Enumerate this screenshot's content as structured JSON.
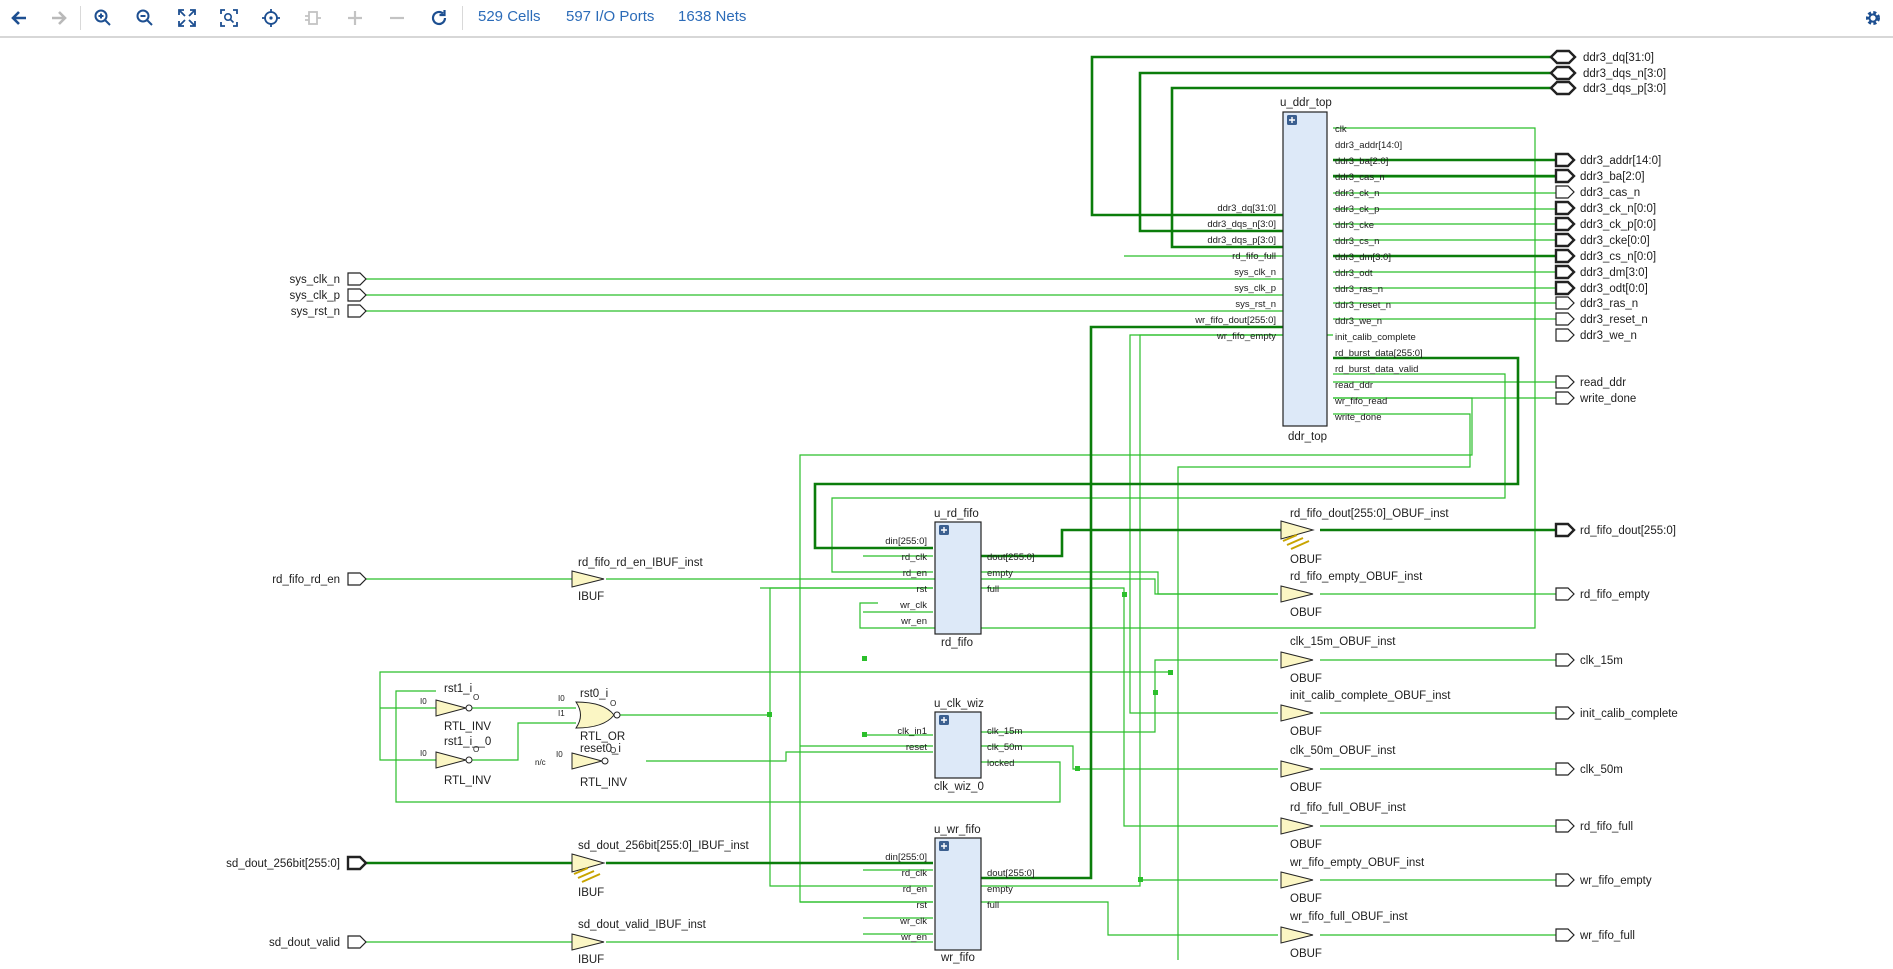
{
  "toolbar": {
    "buttons": [
      {
        "id": "back",
        "icon": "arrow-left-icon"
      },
      {
        "id": "forward",
        "icon": "arrow-right-icon"
      },
      {
        "id": "zoom_in",
        "icon": "zoom-in-icon"
      },
      {
        "id": "zoom_out",
        "icon": "zoom-out-icon"
      },
      {
        "id": "fit",
        "icon": "fit-view-icon"
      },
      {
        "id": "zoom_select",
        "icon": "zoom-selection-icon"
      },
      {
        "id": "autofit",
        "icon": "crosshair-icon"
      },
      {
        "id": "regen",
        "icon": "regenerate-icon"
      },
      {
        "id": "expand",
        "icon": "plus-icon"
      },
      {
        "id": "collapse",
        "icon": "minus-icon"
      },
      {
        "id": "reload",
        "icon": "reload-icon"
      }
    ],
    "cells_label": "529 Cells",
    "ports_label": "597 I/O Ports",
    "nets_label": "1638 Nets",
    "settings_icon": "gear-icon"
  },
  "colors": {
    "wire": "#2bbf2b",
    "bus": "#0b7d0b",
    "block": "#dde9f8",
    "buffer": "#fbf6c4",
    "accent": "#2b6bb8"
  },
  "ports_in": {
    "sys_clk_n": "sys_clk_n",
    "sys_clk_p": "sys_clk_p",
    "sys_rst_n": "sys_rst_n",
    "rd_fifo_rd_en": "rd_fifo_rd_en",
    "sd_dout_256bit": "sd_dout_256bit[255:0]",
    "sd_dout_valid": "sd_dout_valid"
  },
  "ports_out": {
    "ddr3_dq": "ddr3_dq[31:0]",
    "ddr3_dqs_n": "ddr3_dqs_n[3:0]",
    "ddr3_dqs_p": "ddr3_dqs_p[3:0]",
    "ddr3_addr": "ddr3_addr[14:0]",
    "ddr3_ba": "ddr3_ba[2:0]",
    "ddr3_cas_n": "ddr3_cas_n",
    "ddr3_ck_n": "ddr3_ck_n[0:0]",
    "ddr3_ck_p": "ddr3_ck_p[0:0]",
    "ddr3_cke": "ddr3_cke[0:0]",
    "ddr3_cs_n": "ddr3_cs_n[0:0]",
    "ddr3_dm": "ddr3_dm[3:0]",
    "ddr3_odt": "ddr3_odt[0:0]",
    "ddr3_ras_n": "ddr3_ras_n",
    "ddr3_reset_n": "ddr3_reset_n",
    "ddr3_we_n": "ddr3_we_n",
    "read_ddr": "read_ddr",
    "write_done": "write_done",
    "rd_fifo_dout": "rd_fifo_dout[255:0]",
    "rd_fifo_empty": "rd_fifo_empty",
    "clk_15m": "clk_15m",
    "init_calib_complete": "init_calib_complete",
    "clk_50m": "clk_50m",
    "rd_fifo_full": "rd_fifo_full",
    "wr_fifo_empty": "wr_fifo_empty",
    "wr_fifo_full": "wr_fifo_full"
  },
  "u_ddr_top": {
    "name": "u_ddr_top",
    "type": "ddr_top",
    "left_pins": [
      "ddr3_dq[31:0]",
      "ddr3_dqs_n[3:0]",
      "ddr3_dqs_p[3:0]",
      "rd_fifo_full",
      "sys_clk_n",
      "sys_clk_p",
      "sys_rst_n",
      "wr_fifo_dout[255:0]",
      "wr_fifo_empty"
    ],
    "right_pins": [
      "clk",
      "ddr3_addr[14:0]",
      "ddr3_ba[2:0]",
      "ddr3_cas_n",
      "ddr3_ck_n",
      "ddr3_ck_p",
      "ddr3_cke",
      "ddr3_cs_n",
      "ddr3_dm[3:0]",
      "ddr3_odt",
      "ddr3_ras_n",
      "ddr3_reset_n",
      "ddr3_we_n",
      "init_calib_complete",
      "rd_burst_data[255:0]",
      "rd_burst_data_valid",
      "read_ddr",
      "wr_fifo_read",
      "write_done"
    ]
  },
  "u_rd_fifo": {
    "name": "u_rd_fifo",
    "type": "rd_fifo",
    "left_pins": [
      "din[255:0]",
      "rd_clk",
      "rd_en",
      "rst",
      "wr_clk",
      "wr_en"
    ],
    "right_pins": [
      "dout[255:0]",
      "empty",
      "full"
    ]
  },
  "u_wr_fifo": {
    "name": "u_wr_fifo",
    "type": "wr_fifo",
    "left_pins": [
      "din[255:0]",
      "rd_clk",
      "rd_en",
      "rst",
      "wr_clk",
      "wr_en"
    ],
    "right_pins": [
      "dout[255:0]",
      "empty",
      "full"
    ]
  },
  "u_clk_wiz": {
    "name": "u_clk_wiz",
    "type": "clk_wiz_0",
    "left_pins": [
      "clk_in1",
      "reset"
    ],
    "right_pins": [
      "clk_15m",
      "clk_50m",
      "locked"
    ]
  },
  "logic": {
    "rst1_i": "rst1_i",
    "rst1_i_0": "rst1_i__0",
    "rst0_i": "rst0_i",
    "reset0_i": "reset0_i",
    "rtl_inv": "RTL_INV",
    "rtl_or": "RTL_OR",
    "pin_i0": "I0",
    "pin_i1": "I1",
    "pin_o": "O",
    "pin_i": "I",
    "nc": "n/c"
  },
  "buffers": {
    "ibuf_rd_en": "rd_fifo_rd_en_IBUF_inst",
    "ibuf_sd_dout": "sd_dout_256bit[255:0]_IBUF_inst",
    "ibuf_sd_valid": "sd_dout_valid_IBUF_inst",
    "obuf_rd_dout": "rd_fifo_dout[255:0]_OBUF_inst",
    "obuf_rd_empty": "rd_fifo_empty_OBUF_inst",
    "obuf_clk15": "clk_15m_OBUF_inst",
    "obuf_init": "init_calib_complete_OBUF_inst",
    "obuf_clk50": "clk_50m_OBUF_inst",
    "obuf_rd_full": "rd_fifo_full_OBUF_inst",
    "obuf_wr_empty": "wr_fifo_empty_OBUF_inst",
    "obuf_wr_full": "wr_fifo_full_OBUF_inst",
    "ibuf_type": "IBUF",
    "obuf_type": "OBUF"
  }
}
